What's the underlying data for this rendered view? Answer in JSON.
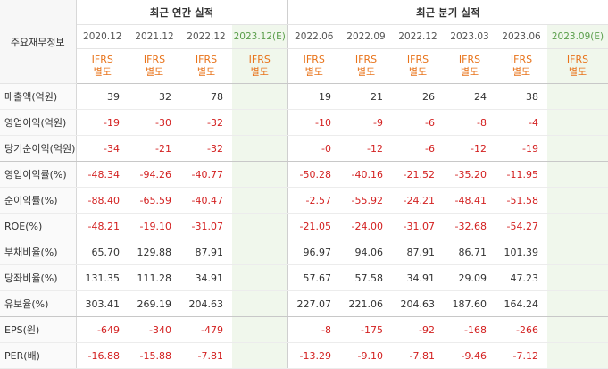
{
  "header": {
    "corner": "주요재무정보",
    "annual_title": "최근 연간 실적",
    "quarter_title": "최근 분기 실적",
    "periods": [
      "2020.12",
      "2021.12",
      "2022.12",
      "2023.12(E)",
      "2022.06",
      "2022.09",
      "2022.12",
      "2023.03",
      "2023.06",
      "2023.09(E)"
    ],
    "ifrs_line1": "IFRS",
    "ifrs_line2": "별도"
  },
  "rows": [
    {
      "label": "매출액(억원)",
      "values": [
        "39",
        "32",
        "78",
        "",
        "19",
        "21",
        "26",
        "24",
        "38",
        ""
      ]
    },
    {
      "label": "영업이익(억원)",
      "values": [
        "-19",
        "-30",
        "-32",
        "",
        "-10",
        "-9",
        "-6",
        "-8",
        "-4",
        ""
      ]
    },
    {
      "label": "당기순이익(억원)",
      "values": [
        "-34",
        "-21",
        "-32",
        "",
        "-0",
        "-12",
        "-6",
        "-12",
        "-19",
        ""
      ]
    },
    {
      "label": "영업이익률(%)",
      "values": [
        "-48.34",
        "-94.26",
        "-40.77",
        "",
        "-50.28",
        "-40.16",
        "-21.52",
        "-35.20",
        "-11.95",
        ""
      ]
    },
    {
      "label": "순이익률(%)",
      "values": [
        "-88.40",
        "-65.59",
        "-40.47",
        "",
        "-2.57",
        "-55.92",
        "-24.21",
        "-48.41",
        "-51.58",
        ""
      ]
    },
    {
      "label": "ROE(%)",
      "values": [
        "-48.21",
        "-19.10",
        "-31.07",
        "",
        "-21.05",
        "-24.00",
        "-31.07",
        "-32.68",
        "-54.27",
        ""
      ]
    },
    {
      "label": "부채비율(%)",
      "values": [
        "65.70",
        "129.88",
        "87.91",
        "",
        "96.97",
        "94.06",
        "87.91",
        "86.71",
        "101.39",
        ""
      ]
    },
    {
      "label": "당좌비율(%)",
      "values": [
        "131.35",
        "111.28",
        "34.91",
        "",
        "57.67",
        "57.58",
        "34.91",
        "29.09",
        "47.23",
        ""
      ]
    },
    {
      "label": "유보율(%)",
      "values": [
        "303.41",
        "269.19",
        "204.63",
        "",
        "227.07",
        "221.06",
        "204.63",
        "187.60",
        "164.24",
        ""
      ]
    },
    {
      "label": "EPS(원)",
      "values": [
        "-649",
        "-340",
        "-479",
        "",
        "-8",
        "-175",
        "-92",
        "-168",
        "-266",
        ""
      ]
    },
    {
      "label": "PER(배)",
      "values": [
        "-16.88",
        "-15.88",
        "-7.81",
        "",
        "-13.29",
        "-9.10",
        "-7.81",
        "-9.46",
        "-7.12",
        ""
      ]
    }
  ],
  "colors": {
    "negative": "#d32020",
    "ifrs": "#e8731a",
    "estimate_bg": "#f0f7ec",
    "estimate_text": "#5a9e4b"
  }
}
